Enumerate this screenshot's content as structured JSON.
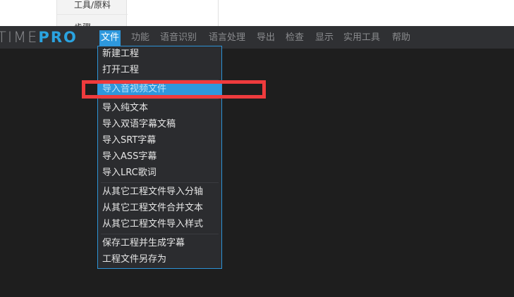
{
  "top_panel": {
    "item1": "工具/原料",
    "item2": "步骤"
  },
  "logo": {
    "part1": "TIME",
    "part2": "PRO"
  },
  "menubar": {
    "items": [
      "文件",
      "功能",
      "语音识别",
      "语言处理",
      "导出",
      "检查",
      "显示",
      "实用工具",
      "帮助"
    ]
  },
  "file_menu": {
    "items": [
      "新建工程",
      "打开工程",
      "导入音视频文件",
      "导入纯文本",
      "导入双语字幕文稿",
      "导入SRT字幕",
      "导入ASS字幕",
      "导入LRC歌词",
      "从其它工程文件导入分轴",
      "从其它工程文件合并文本",
      "从其它工程文件导入样式",
      "保存工程并生成字幕",
      "工程文件另存为"
    ]
  },
  "colors": {
    "accent": "#2e98dd",
    "annotation": "#ef3b3d",
    "menubar_bg": "#2f3033",
    "workspace_bg": "#1e1e1e"
  }
}
